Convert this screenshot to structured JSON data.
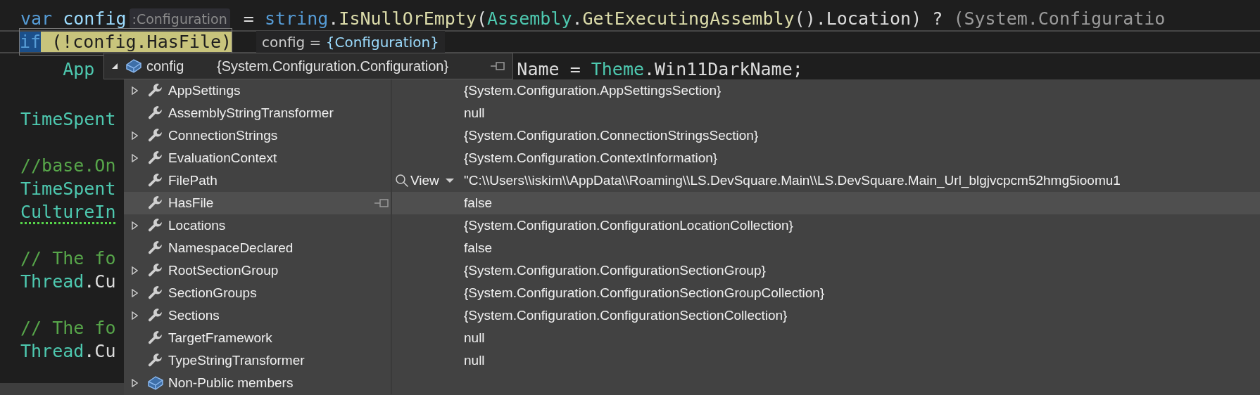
{
  "editor": {
    "lines": [
      {
        "segments": [
          {
            "text": "var ",
            "kind": "keyword"
          },
          {
            "text": "config",
            "kind": "variable"
          },
          {
            "text": ":Configuration",
            "kind": "hint"
          },
          {
            "text": " = ",
            "kind": "plain"
          },
          {
            "text": "string",
            "kind": "keyword"
          },
          {
            "text": ".",
            "kind": "plain"
          },
          {
            "text": "IsNullOrEmpty",
            "kind": "method"
          },
          {
            "text": "(",
            "kind": "plain"
          },
          {
            "text": "Assembly",
            "kind": "type"
          },
          {
            "text": ".",
            "kind": "plain"
          },
          {
            "text": "GetExecutingAssembly",
            "kind": "method"
          },
          {
            "text": "().",
            "kind": "plain"
          },
          {
            "text": "Location",
            "kind": "plain"
          },
          {
            "text": ") ? ",
            "kind": "plain"
          },
          {
            "text": "(System.Configuratio",
            "kind": "dim"
          }
        ]
      },
      {
        "current": true,
        "segments": [
          {
            "text": "if",
            "kind": "keyword",
            "selected": true
          },
          {
            "text": " (!config.HasFile)",
            "kind": "dark",
            "match_highlight": true
          }
        ],
        "datatip": {
          "expression": "config",
          "separator": "=",
          "value": "{Configuration}"
        }
      },
      {
        "segments": [
          {
            "text": "    App",
            "kind": "type"
          }
        ],
        "after_popup": [
          {
            "text": "Name",
            "kind": "plain"
          },
          {
            "text": " = ",
            "kind": "plain"
          },
          {
            "text": "Theme",
            "kind": "type"
          },
          {
            "text": ".Win11DarkName;",
            "kind": "plain"
          }
        ]
      },
      {
        "blank_before": true,
        "segments": [
          {
            "text": "TimeSpent",
            "kind": "type"
          }
        ]
      },
      {
        "blank_before": true,
        "segments": [
          {
            "text": "//base.On",
            "kind": "comment"
          }
        ]
      },
      {
        "segments": [
          {
            "text": "TimeSpent",
            "kind": "type"
          }
        ]
      },
      {
        "segments": [
          {
            "text": "CultureIn",
            "kind": "type",
            "suggestion": true
          }
        ]
      },
      {
        "blank_before": true,
        "segments": [
          {
            "text": "// The fo",
            "kind": "comment"
          }
        ]
      },
      {
        "segments": [
          {
            "text": "Thread",
            "kind": "type"
          },
          {
            "text": ".Cu",
            "kind": "plain"
          }
        ]
      },
      {
        "blank_before": true,
        "segments": [
          {
            "text": "// The fo",
            "kind": "comment"
          }
        ]
      },
      {
        "segments": [
          {
            "text": "Thread",
            "kind": "type"
          },
          {
            "text": ".Cu",
            "kind": "plain"
          }
        ]
      }
    ]
  },
  "datatip_panel": {
    "header": {
      "name": "config",
      "value": "{System.Configuration.Configuration}",
      "expanded": true
    },
    "rows": [
      {
        "name": "AppSettings",
        "value": "{System.Configuration.AppSettingsSection}",
        "kind": "property",
        "expandable": true,
        "selected": false
      },
      {
        "name": "AssemblyStringTransformer",
        "value": "null",
        "kind": "property",
        "expandable": false,
        "selected": false
      },
      {
        "name": "ConnectionStrings",
        "value": "{System.Configuration.ConnectionStringsSection}",
        "kind": "property",
        "expandable": true,
        "selected": false
      },
      {
        "name": "EvaluationContext",
        "value": "{System.Configuration.ContextInformation}",
        "kind": "property",
        "expandable": true,
        "selected": false
      },
      {
        "name": "FilePath",
        "value": "\"C:\\\\Users\\\\iskim\\\\AppData\\\\Roaming\\\\LS.DevSquare.Main\\\\LS.DevSquare.Main_Url_blgjvcpcm52hmg5ioomu1",
        "kind": "property",
        "expandable": false,
        "selected": false,
        "visualizer": "View"
      },
      {
        "name": "HasFile",
        "value": "false",
        "kind": "property",
        "expandable": false,
        "selected": true
      },
      {
        "name": "Locations",
        "value": "{System.Configuration.ConfigurationLocationCollection}",
        "kind": "property",
        "expandable": true,
        "selected": false
      },
      {
        "name": "NamespaceDeclared",
        "value": "false",
        "kind": "property",
        "expandable": false,
        "selected": false
      },
      {
        "name": "RootSectionGroup",
        "value": "{System.Configuration.ConfigurationSectionGroup}",
        "kind": "property",
        "expandable": true,
        "selected": false
      },
      {
        "name": "SectionGroups",
        "value": "{System.Configuration.ConfigurationSectionGroupCollection}",
        "kind": "property",
        "expandable": true,
        "selected": false
      },
      {
        "name": "Sections",
        "value": "{System.Configuration.ConfigurationSectionCollection}",
        "kind": "property",
        "expandable": true,
        "selected": false
      },
      {
        "name": "TargetFramework",
        "value": "null",
        "kind": "property",
        "expandable": false,
        "selected": false
      },
      {
        "name": "TypeStringTransformer",
        "value": "null",
        "kind": "property",
        "expandable": false,
        "selected": false
      },
      {
        "name": "Non-Public members",
        "kind": "group",
        "expandable": true,
        "selected": false
      }
    ]
  }
}
